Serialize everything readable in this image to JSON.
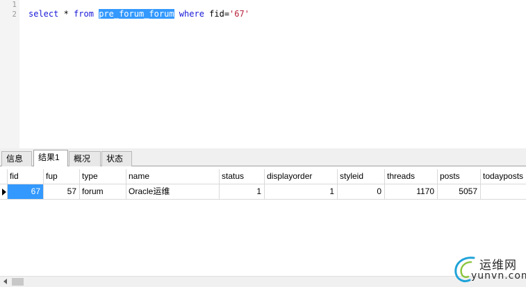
{
  "editor": {
    "line_numbers": [
      "1",
      "2"
    ],
    "query": {
      "kw_select": "select",
      "star": " * ",
      "kw_from": "from",
      "space1": " ",
      "table": "pre_forum_forum",
      "space2": " ",
      "kw_where": "where",
      "cond": " fid=",
      "value": "'67'"
    }
  },
  "tabs": [
    {
      "label": "信息",
      "active": false
    },
    {
      "label": "结果1",
      "active": true
    },
    {
      "label": "概况",
      "active": false
    },
    {
      "label": "状态",
      "active": false
    }
  ],
  "grid": {
    "columns": [
      "fid",
      "fup",
      "type",
      "name",
      "status",
      "displayorder",
      "styleid",
      "threads",
      "posts",
      "todayposts"
    ],
    "rows": [
      [
        "67",
        "57",
        "forum",
        "Oracle运维",
        "1",
        "1",
        "0",
        "1170",
        "5057",
        ""
      ]
    ]
  },
  "watermark": {
    "cn": "运维网",
    "en": "yunvn.com"
  },
  "colors": {
    "selection": "#3399ff",
    "keyword": "#1717d8",
    "string": "#b8203a"
  }
}
